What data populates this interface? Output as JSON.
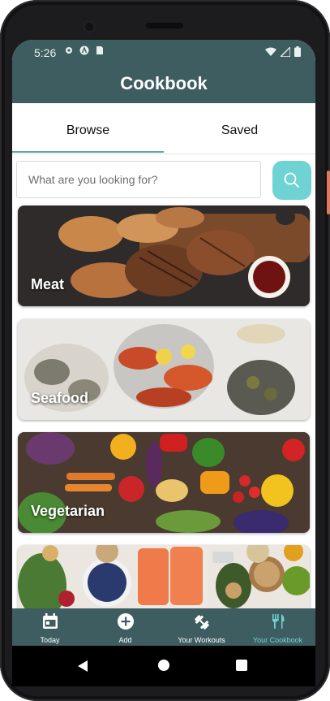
{
  "status_bar": {
    "time": "5:26",
    "icons": [
      "gear-icon",
      "a-badge-icon",
      "sim-icon",
      "wifi-icon",
      "signal-icon",
      "battery-icon"
    ]
  },
  "app": {
    "title": "Cookbook"
  },
  "tabs": [
    {
      "label": "Browse",
      "selected": true
    },
    {
      "label": "Saved",
      "selected": false
    }
  ],
  "search": {
    "placeholder": "What are you looking for?",
    "value": ""
  },
  "categories": [
    {
      "label": "Meat"
    },
    {
      "label": "Seafood"
    },
    {
      "label": "Vegetarian"
    },
    {
      "label": ""
    }
  ],
  "bottom_nav": [
    {
      "label": "Today",
      "icon": "calendar-icon"
    },
    {
      "label": "Add",
      "icon": "add-circle-icon"
    },
    {
      "label": "Your Workouts",
      "icon": "dumbbell-icon"
    },
    {
      "label": "Your Cookbook",
      "icon": "fork-knife-icon",
      "active": true
    }
  ],
  "colors": {
    "primary": "#3e5d60",
    "accent": "#6fd3d3",
    "tab_indicator": "#62a6a8"
  }
}
